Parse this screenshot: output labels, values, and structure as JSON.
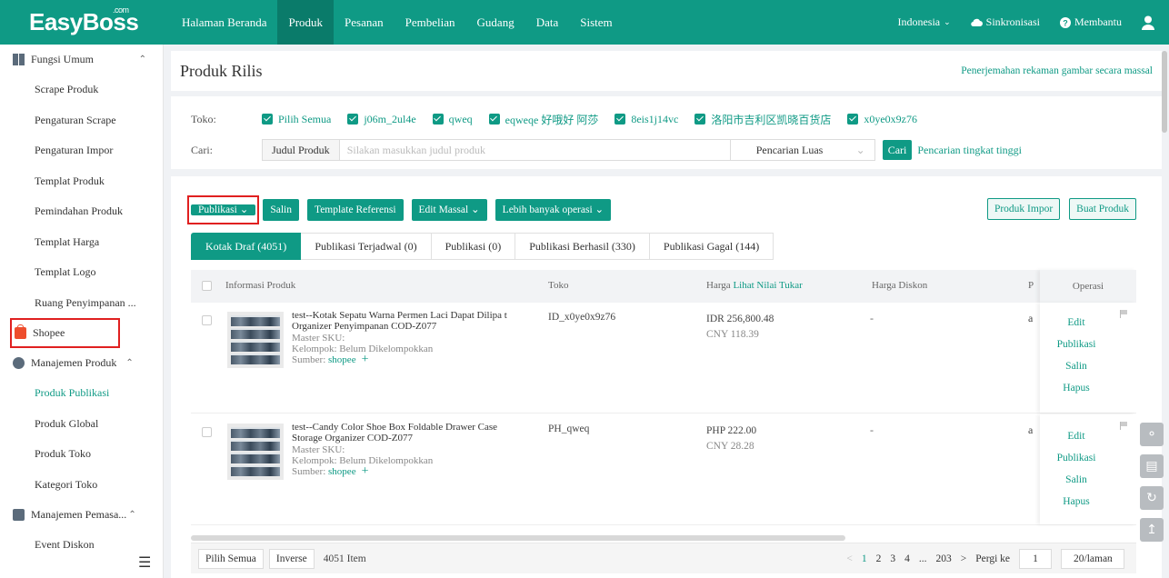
{
  "app": {
    "logo": "EasyBoss",
    "logo_sup": ".com"
  },
  "topnav": {
    "items": [
      "Halaman Beranda",
      "Produk",
      "Pesanan",
      "Pembelian",
      "Gudang",
      "Data",
      "Sistem"
    ],
    "active": "Produk",
    "region": "Indonesia",
    "sync": "Sinkronisasi",
    "help": "Membantu"
  },
  "sidebar": {
    "group_umum": "Fungsi Umum",
    "umum_items": [
      "Scrape Produk",
      "Pengaturan Scrape",
      "Pengaturan Impor",
      "Templat Produk",
      "Pemindahan Produk",
      "Templat Harga",
      "Templat Logo",
      "Ruang Penyimpanan ..."
    ],
    "shopee": "Shopee",
    "group_produk": "Manajemen Produk",
    "produk_items": [
      "Produk Publikasi",
      "Produk Global",
      "Produk Toko",
      "Kategori Toko"
    ],
    "group_pemasaran": "Manajemen Pemasa...",
    "pemasaran_items": [
      "Event Diskon"
    ]
  },
  "page": {
    "title": "Produk Rilis",
    "right_link": "Penerjemahan rekaman gambar secara massal"
  },
  "filters": {
    "toko_label": "Toko:",
    "stores": [
      "Pilih Semua",
      "j06m_2ul4e",
      "qweq",
      "eqweqe 好哦好 阿莎",
      "8eis1j14vc",
      "洛阳市吉利区凯晓百货店",
      "x0ye0x9z76"
    ],
    "cari_label": "Cari:",
    "field_button": "Judul Produk",
    "search_placeholder": "Silakan masukkan judul produk",
    "search_mode": "Pencarian Luas",
    "search_button": "Cari",
    "advanced_link": "Pencarian tingkat tinggi"
  },
  "toolbar": {
    "publish": "Publikasi",
    "copy": "Salin",
    "template_ref": "Template Referensi",
    "bulk_edit": "Edit Massal",
    "more_ops": "Lebih banyak operasi",
    "import": "Produk Impor",
    "create": "Buat Produk"
  },
  "tabs": [
    "Kotak Draf (4051)",
    "Publikasi Terjadwal (0)",
    "Publikasi (0)",
    "Publikasi Berhasil (330)",
    "Publikasi Gagal (144)"
  ],
  "table": {
    "headers": {
      "info": "Informasi Produk",
      "toko": "Toko",
      "harga": "Harga",
      "harga_link": "Lihat Nilai Tukar",
      "diskon": "Harga Diskon",
      "p": "P",
      "ops": "Operasi"
    },
    "rows": [
      {
        "title": "test--Kotak Sepatu Warna Permen Laci Dapat Dilipa t Organizer Penyimpanan COD-Z077",
        "sku": "Master SKU:",
        "group": "Kelompok:  Belum Dikelompokkan",
        "source_label": "Sumber:",
        "source": "shopee",
        "store": "ID_x0ye0x9z76",
        "price": "IDR 256,800.48",
        "price_cny": "CNY 118.39",
        "discount": "-",
        "p": "a",
        "ops": [
          "Edit",
          "Publikasi",
          "Salin",
          "Hapus"
        ]
      },
      {
        "title": "test--Candy Color Shoe Box Foldable Drawer Case Storage Organizer COD-Z077",
        "sku": "Master SKU:",
        "group": "Kelompok:  Belum Dikelompokkan",
        "source_label": "Sumber:",
        "source": "shopee",
        "store": "PH_qweq",
        "price": "PHP 222.00",
        "price_cny": "CNY 28.28",
        "discount": "-",
        "p": "a",
        "ops": [
          "Edit",
          "Publikasi",
          "Salin",
          "Hapus"
        ]
      }
    ]
  },
  "footer": {
    "select_all": "Pilih Semua",
    "inverse": "Inverse",
    "count": "4051 Item",
    "pages": [
      "1",
      "2",
      "3",
      "4",
      "...",
      "203"
    ],
    "goto_label": "Pergi ke",
    "goto_value": "1",
    "page_size": "20/laman"
  },
  "colors": {
    "primary": "#0f9a85",
    "highlight": "#e02020",
    "shopee": "#ee4d2d"
  }
}
